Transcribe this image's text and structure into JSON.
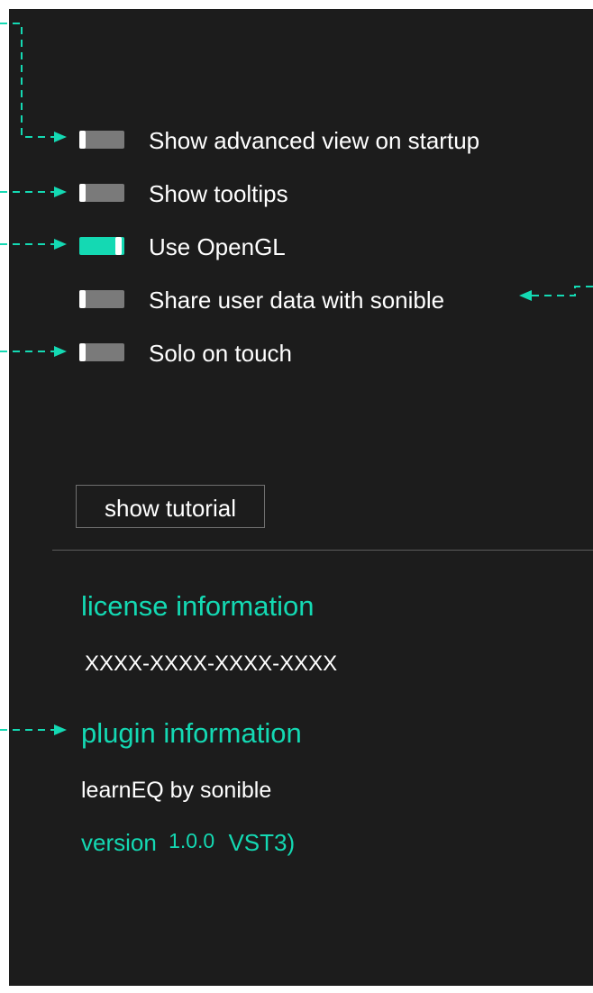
{
  "colors": {
    "panel": "#1c1c1c",
    "accent": "#14d9b3",
    "toggle_off": "#7a7a7a",
    "text": "#ffffff",
    "annotation": "#14d9b3"
  },
  "settings": [
    {
      "label": "Show advanced view on startup",
      "enabled": false
    },
    {
      "label": "Show tooltips",
      "enabled": false
    },
    {
      "label": "Use OpenGL",
      "enabled": true
    },
    {
      "label": "Share user data with sonible",
      "enabled": false
    },
    {
      "label": "Solo on touch",
      "enabled": false
    }
  ],
  "tutorial_button": {
    "label": "show tutorial"
  },
  "license": {
    "heading": "license information",
    "key": "XXXX-XXXX-XXXX-XXXX"
  },
  "plugin": {
    "heading": "plugin information",
    "name": "learnEQ by sonible",
    "version_label": "version",
    "version_number": "1.0.0",
    "format": "VST3)"
  }
}
